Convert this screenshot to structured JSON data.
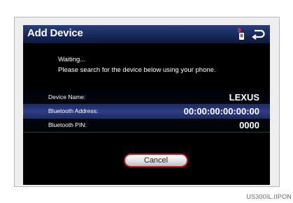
{
  "screen": {
    "title": "Add Device",
    "status_icon": "bluetooth-phone-icon",
    "back_icon": "back-arrow-icon",
    "message": {
      "line1": "Waiting...",
      "line2": "Please search for the device below using your phone."
    },
    "info_rows": [
      {
        "label": "Device Name:",
        "value": "LEXUS"
      },
      {
        "label": "Bluetooth Address:",
        "value": "00:00:00:00:00:00"
      },
      {
        "label": "Bluetooth PIN:",
        "value": "0000"
      }
    ],
    "cancel_label": "Cancel"
  },
  "caption": "US300IL.IIPON",
  "colors": {
    "header_blue": "#172a5c",
    "highlight_blue": "#2f3f86",
    "cancel_outline_red": "#c21a1a",
    "screen_background": "#000000"
  }
}
